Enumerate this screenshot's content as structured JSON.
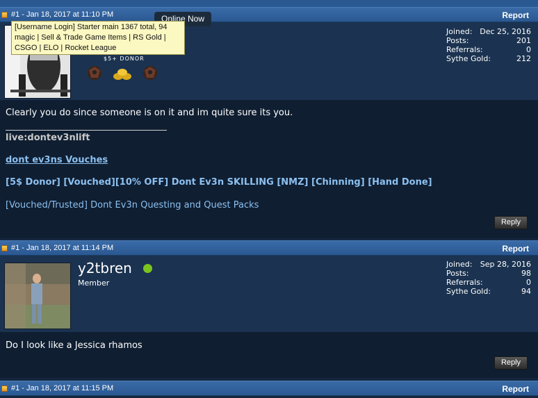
{
  "posts": [
    {
      "date": "#1 - Jan 18, 2017 at 11:10 PM",
      "report": "Report",
      "tooltip": "[Username Login] Starter main 1367 total, 94 magic | Sell & Trade Game Items | RS Gold | CSGO | ELO | Rocket League",
      "online_label": "Online Now",
      "donor_label": "$5+ DONOR",
      "stats": [
        {
          "label": "Joined:",
          "value": "Dec 25, 2016"
        },
        {
          "label": "Posts:",
          "value": "201"
        },
        {
          "label": "Referrals:",
          "value": "0"
        },
        {
          "label": "Sythe Gold:",
          "value": "212"
        }
      ],
      "message": "Clearly you do since someone is on it and im quite sure its you.",
      "signature": {
        "line1": "live:dontev3nlift",
        "line2": "dont ev3ns Vouches",
        "line3": "[5$ Donor] [Vouched][10% OFF] Dont Ev3n SKILLING [NMZ] [Chinning] [Hand Done]",
        "line4": "[Vouched/Trusted] Dont Ev3n Questing and Quest Packs"
      },
      "reply": "Reply"
    },
    {
      "date": "#1 - Jan 18, 2017 at 11:14 PM",
      "report": "Report",
      "username": "y2tbren",
      "rank": "Member",
      "stats": [
        {
          "label": "Joined:",
          "value": "Sep 28, 2016"
        },
        {
          "label": "Posts:",
          "value": "98"
        },
        {
          "label": "Referrals:",
          "value": "0"
        },
        {
          "label": "Sythe Gold:",
          "value": "94"
        }
      ],
      "message": "Do I look like a Jessica rhamos",
      "reply": "Reply"
    },
    {
      "date": "#1 - Jan 18, 2017 at 11:15 PM",
      "report": "Report"
    }
  ],
  "colors": {
    "header": "#2a5891",
    "body": "#0f1e31",
    "userrow": "#1b3350",
    "signature_link": "#8cc0f0",
    "online": "#7bc420"
  }
}
